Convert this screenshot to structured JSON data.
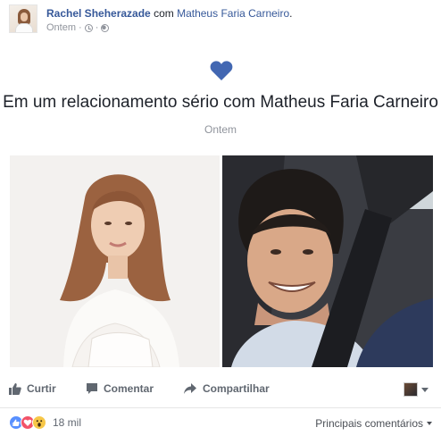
{
  "post": {
    "author": "Rachel Sheherazade",
    "with_prefix": "com",
    "with_name": "Matheus Faria Carneiro",
    "with_suffix": ".",
    "time": "Ontem",
    "meta_sep": "·",
    "privacy_icon": "globe-icon",
    "clock_icon": "clock-icon"
  },
  "event": {
    "icon": "heart-icon",
    "title": "Em um relacionamento sério com Matheus Faria Carneiro",
    "date": "Ontem"
  },
  "actions": {
    "like": "Curtir",
    "comment": "Comentar",
    "share": "Compartilhar"
  },
  "footer": {
    "reaction_icons": [
      "like-reaction-icon",
      "love-reaction-icon",
      "wow-reaction-icon"
    ],
    "count": "18 mil",
    "sort_label": "Principais comentários"
  },
  "colors": {
    "link": "#365899",
    "heart": "#4267b2",
    "muted": "#90949c",
    "action_text": "#606770"
  }
}
